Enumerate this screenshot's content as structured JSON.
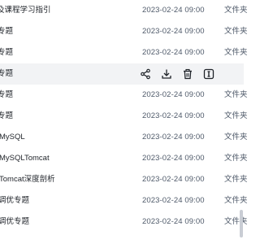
{
  "rows": [
    {
      "name": "及课程学习指引",
      "date": "2023-02-24 09:00",
      "type": "文件夹"
    },
    {
      "name": "专题",
      "date": "2023-02-24 09:00",
      "type": "文件夹"
    },
    {
      "name": "专题",
      "date": "2023-02-24 09:00",
      "type": "文件夹"
    },
    {
      "name": "专题",
      "date": "",
      "type": ""
    },
    {
      "name": "专题",
      "date": "2023-02-24 09:00",
      "type": "文件夹"
    },
    {
      "name": "专题",
      "date": "2023-02-24 09:00",
      "type": "文件夹"
    },
    {
      "name": "MySQL",
      "date": "2023-02-24 09:00",
      "type": "文件夹"
    },
    {
      "name": "MySQLTomcat",
      "date": "2023-02-24 09:00",
      "type": "文件夹"
    },
    {
      "name": "Tomcat深度剖析",
      "date": "2023-02-24 09:00",
      "type": "文件夹"
    },
    {
      "name": "调优专题",
      "date": "2023-02-24 09:00",
      "type": "文件夹"
    },
    {
      "name": "调优专题",
      "date": "2023-02-24 09:00",
      "type": "文件夹"
    }
  ],
  "hover_actions": [
    "share-icon",
    "download-icon",
    "delete-icon",
    "rename-icon"
  ],
  "colors": {
    "hover_bg": "#f2f3f5",
    "text": "#1f2329",
    "muted": "#4e5969"
  }
}
